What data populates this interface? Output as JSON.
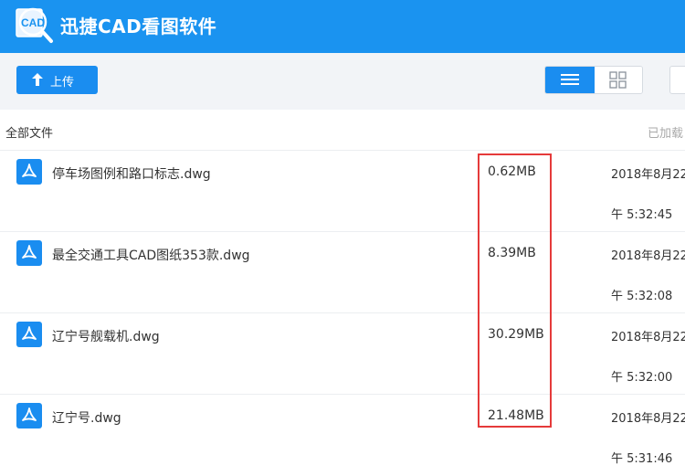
{
  "app": {
    "title": "迅捷CAD看图软件",
    "logo_text": "CAD"
  },
  "toolbar": {
    "upload_label": "上传",
    "upload_icon": "arrow-up-icon",
    "view_list_icon": "list-view-icon",
    "view_grid_icon": "grid-view-icon",
    "accent": "#1a8df0"
  },
  "breadcrumb": "全部文件",
  "loaded_text": "已加载",
  "files": [
    {
      "name": "停车场图例和路口标志.dwg",
      "size": "0.62MB",
      "date": "2018年8月22",
      "time": "午 5:32:45"
    },
    {
      "name": "最全交通工具CAD图纸353款.dwg",
      "size": "8.39MB",
      "date": "2018年8月22",
      "time": "午 5:32:08"
    },
    {
      "name": "辽宁号舰载机.dwg",
      "size": "30.29MB",
      "date": "2018年8月22",
      "time": "午 5:32:00"
    },
    {
      "name": "辽宁号.dwg",
      "size": "21.48MB",
      "date": "2018年8月22",
      "time": "午 5:31:46"
    }
  ],
  "colors": {
    "header": "#1a93f0",
    "highlight_box": "#e53a3a"
  }
}
